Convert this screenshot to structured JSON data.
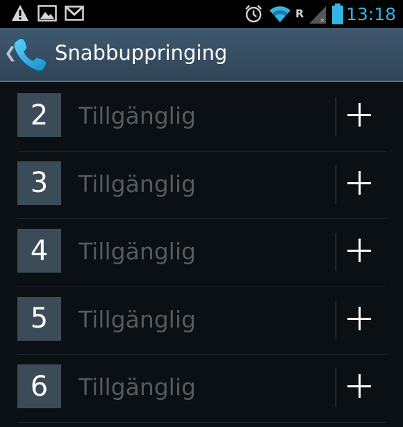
{
  "status_bar": {
    "time": "13:18",
    "icons": [
      "warning-icon",
      "image-icon",
      "gmail-icon",
      "alarm-icon",
      "wifi-icon",
      "roaming-icon",
      "signal-icon",
      "battery-icon"
    ],
    "roaming_text": "R",
    "accent_color": "#34b5e5"
  },
  "action_bar": {
    "title": "Snabbuppringing",
    "icon": "phone-icon"
  },
  "speed_dial": [
    {
      "number": "2",
      "label": "Tillgänglig"
    },
    {
      "number": "3",
      "label": "Tillgänglig"
    },
    {
      "number": "4",
      "label": "Tillgänglig"
    },
    {
      "number": "5",
      "label": "Tillgänglig"
    },
    {
      "number": "6",
      "label": "Tillgänglig"
    }
  ]
}
